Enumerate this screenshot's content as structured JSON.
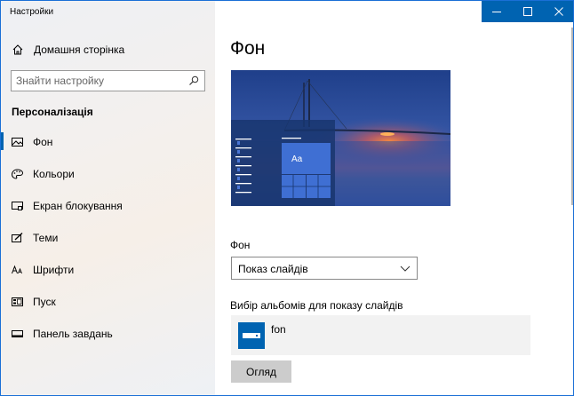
{
  "window": {
    "title": "Настройки",
    "minimize_symbol": "—",
    "maximize_symbol": "☐",
    "close_symbol": "✕"
  },
  "sidebar": {
    "home": {
      "label": "Домашня сторінка",
      "icon": "home-icon"
    },
    "search": {
      "placeholder": "Знайти настройку",
      "icon": "search-icon"
    },
    "section_title": "Персоналізація",
    "items": [
      {
        "label": "Фон",
        "icon": "picture-icon",
        "active": true
      },
      {
        "label": "Кольори",
        "icon": "palette-icon",
        "active": false
      },
      {
        "label": "Екран блокування",
        "icon": "lock-screen-icon",
        "active": false
      },
      {
        "label": "Теми",
        "icon": "brush-icon",
        "active": false
      },
      {
        "label": "Шрифти",
        "icon": "font-icon",
        "active": false
      },
      {
        "label": "Пуск",
        "icon": "start-icon",
        "active": false
      },
      {
        "label": "Панель завдань",
        "icon": "taskbar-icon",
        "active": false
      }
    ]
  },
  "main": {
    "title": "Фон",
    "preview": {
      "tile_text": "Aa"
    },
    "background_label": "Фон",
    "background_value": "Показ слайдів",
    "albums_label": "Вибір альбомів для показу слайдів",
    "album_name": "fon",
    "browse_label": "Огляд"
  },
  "colors": {
    "accent": "#0063b1",
    "window_border": "#1a6fd6"
  }
}
